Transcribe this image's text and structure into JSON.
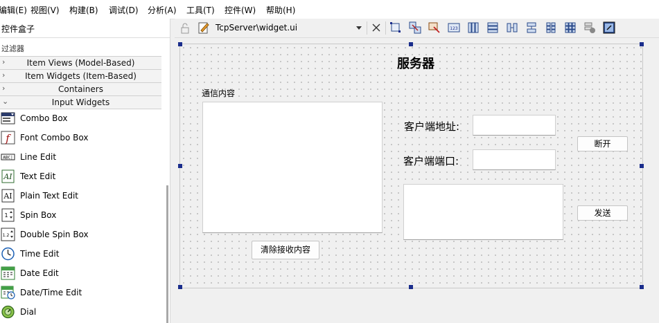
{
  "menu": [
    "编辑(E)",
    "视图(V)",
    "构建(B)",
    "调试(D)",
    "分析(A)",
    "工具(T)",
    "控件(W)",
    "帮助(H)"
  ],
  "widget_box": {
    "title": "控件盒子",
    "filter_label": "过滤器",
    "categories": [
      "Item Views (Model-Based)",
      "Item Widgets (Item-Based)",
      "Containers",
      "Input Widgets"
    ],
    "items": [
      "Combo Box",
      "Font Combo Box",
      "Line Edit",
      "Text Edit",
      "Plain Text Edit",
      "Spin Box",
      "Double Spin Box",
      "Time Edit",
      "Date Edit",
      "Date/Time Edit",
      "Dial"
    ],
    "icon_text": {
      "line_edit": "ABC|",
      "text_edit": "AI",
      "plain_text_edit": "AI",
      "spin_box": "1",
      "double_spin_box": "1.2",
      "font_combo": "f"
    }
  },
  "document": {
    "title": "TcpServer\\widget.ui"
  },
  "form": {
    "title": "服务器",
    "group_label": "通信内容",
    "client_addr_label": "客户端地址:",
    "client_port_label": "客户端端口:",
    "disconnect_button": "断开",
    "send_button": "发送",
    "clear_button": "清除接收内容"
  }
}
